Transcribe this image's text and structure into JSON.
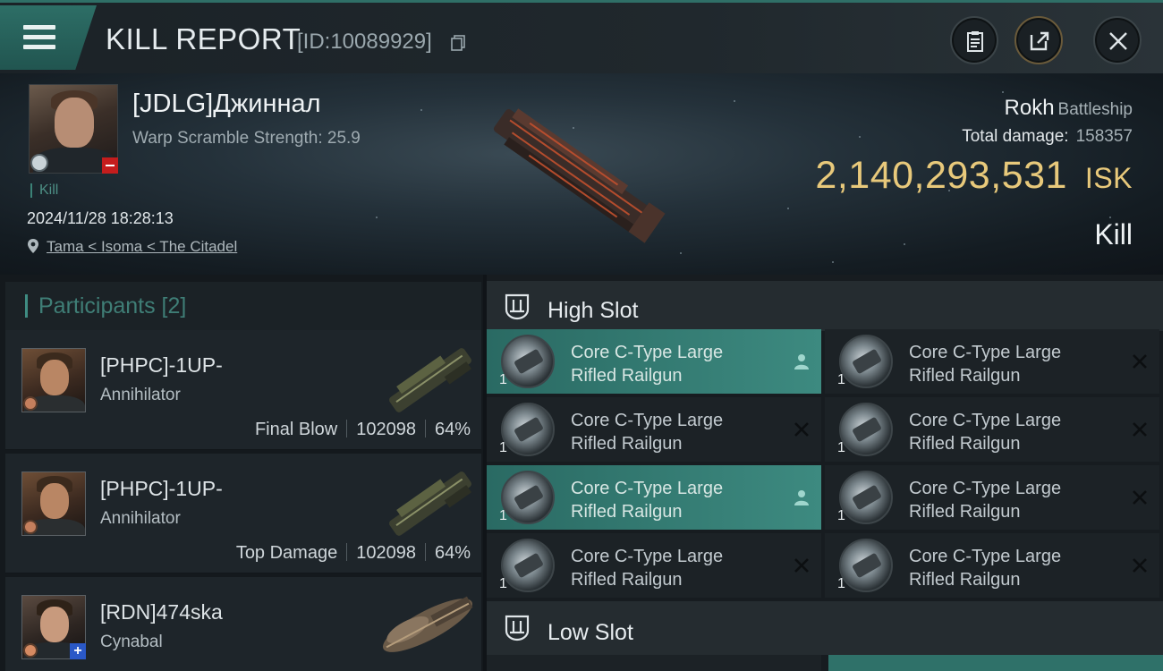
{
  "header": {
    "title": "KILL REPORT",
    "report_id": "[ID:10089929]"
  },
  "victim": {
    "name": "[JDLG]Джиннал",
    "warp_scramble": "Warp Scramble Strength: 25.9",
    "tag": "Kill",
    "datetime": "2024/11/28 18:28:13",
    "location": "Tama < Isoma < The Citadel",
    "ship": "Rokh",
    "ship_class": "Battleship",
    "total_damage_label": "Total damage:",
    "total_damage": "158357",
    "isk_value": "2,140,293,531",
    "isk_unit": "ISK",
    "result": "Kill"
  },
  "participants": {
    "title": "Participants [2]",
    "items": [
      {
        "name": "[PHPC]-1UP-",
        "ship": "Annihilator",
        "role": "Final Blow",
        "damage": "102098",
        "percent": "64%"
      },
      {
        "name": "[PHPC]-1UP-",
        "ship": "Annihilator",
        "role": "Top Damage",
        "damage": "102098",
        "percent": "64%"
      },
      {
        "name": "[RDN]474ska",
        "ship": "Cynabal"
      }
    ]
  },
  "slots": {
    "high_label": "High Slot",
    "low_label": "Low Slot",
    "modules": [
      {
        "line1": "Core C-Type Large",
        "line2": "Rifled Railgun",
        "qty": "1",
        "status": "person"
      },
      {
        "line1": "Core C-Type Large",
        "line2": "Rifled Railgun",
        "qty": "1",
        "status": "destroyed"
      },
      {
        "line1": "Core C-Type Large",
        "line2": "Rifled Railgun",
        "qty": "1",
        "status": "destroyed"
      },
      {
        "line1": "Core C-Type Large",
        "line2": "Rifled Railgun",
        "qty": "1",
        "status": "destroyed"
      },
      {
        "line1": "Core C-Type Large",
        "line2": "Rifled Railgun",
        "qty": "1",
        "status": "person"
      },
      {
        "line1": "Core C-Type Large",
        "line2": "Rifled Railgun",
        "qty": "1",
        "status": "destroyed"
      },
      {
        "line1": "Core C-Type Large",
        "line2": "Rifled Railgun",
        "qty": "1",
        "status": "destroyed"
      },
      {
        "line1": "Core C-Type Large",
        "line2": "Rifled Railgun",
        "qty": "1",
        "status": "destroyed"
      }
    ]
  },
  "colors": {
    "accent": "#3f8c82",
    "isk": "#e8c97b",
    "highlight_slot": "#3d8a80",
    "danger": "#c41d1d"
  }
}
